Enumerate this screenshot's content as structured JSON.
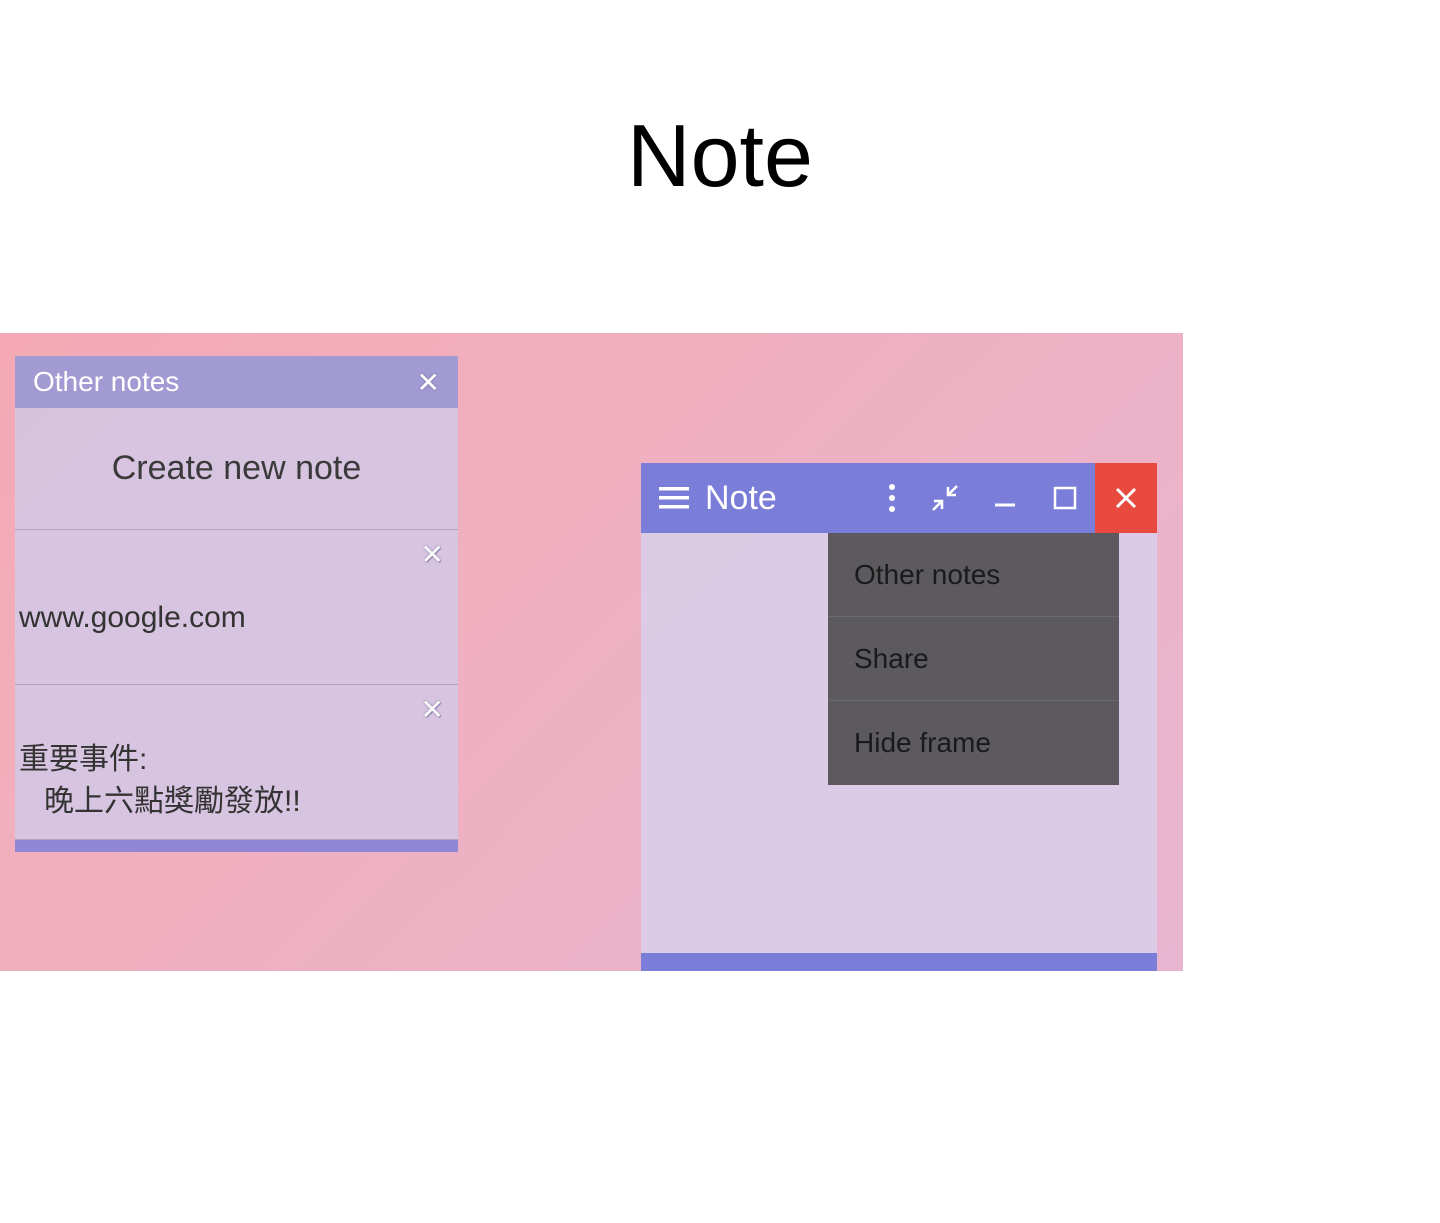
{
  "page": {
    "title": "Note"
  },
  "other_notes_panel": {
    "header_title": "Other notes",
    "create_label": "Create new note",
    "items": [
      {
        "content": "www.google.com"
      },
      {
        "content": "重要事件:\n   晚上六點獎勵發放!!"
      }
    ]
  },
  "note_window": {
    "title": "Note"
  },
  "context_menu": {
    "items": [
      {
        "label": "Other notes"
      },
      {
        "label": "Share"
      },
      {
        "label": "Hide frame"
      }
    ]
  },
  "icons": {
    "close_x": "✕"
  }
}
